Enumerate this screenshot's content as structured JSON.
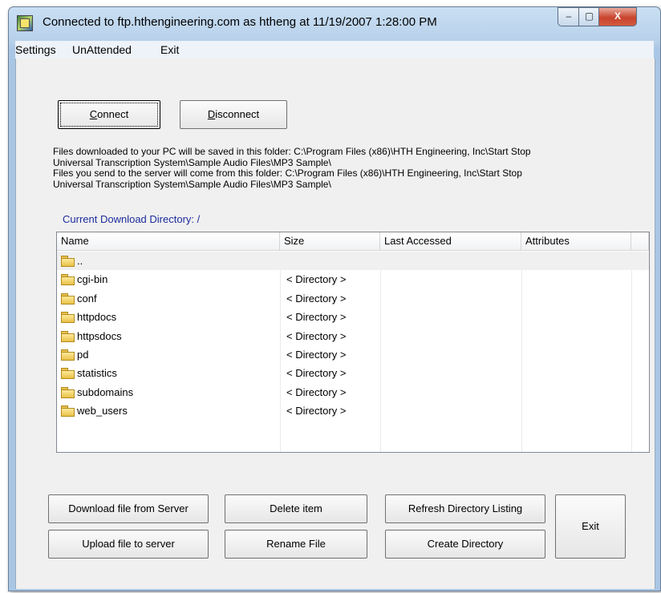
{
  "window": {
    "title": "Connected to ftp.hthengineering.com as htheng at 11/19/2007 1:28:00 PM",
    "controls": {
      "minimize": "–",
      "maximize": "▢",
      "close": "X"
    }
  },
  "menu": [
    "Settings",
    "UnAttended",
    "Exit"
  ],
  "top_buttons": {
    "connect": {
      "underline": "C",
      "rest": "onnect"
    },
    "disconnect": {
      "underline": "D",
      "rest": "isconnect"
    }
  },
  "info": {
    "download_line1": "Files downloaded to your PC will be saved in this folder: C:\\Program Files (x86)\\HTH Engineering, Inc\\Start Stop",
    "download_line2": "Universal Transcription System\\Sample Audio Files\\MP3 Sample\\",
    "upload_line1": "Files you send to the server will come from this folder: C:\\Program Files (x86)\\HTH Engineering, Inc\\Start Stop",
    "upload_line2": "Universal Transcription System\\Sample Audio Files\\MP3 Sample\\"
  },
  "current_dir": "Current Download Directory: /",
  "columns": [
    "Name",
    "Size",
    "Last Accessed",
    "Attributes"
  ],
  "rows": [
    {
      "name": "..",
      "size": ""
    },
    {
      "name": "cgi-bin",
      "size": "< Directory >"
    },
    {
      "name": "conf",
      "size": "< Directory >"
    },
    {
      "name": "httpdocs",
      "size": "< Directory >"
    },
    {
      "name": "httpsdocs",
      "size": "< Directory >"
    },
    {
      "name": "pd",
      "size": "< Directory >"
    },
    {
      "name": "statistics",
      "size": "< Directory >"
    },
    {
      "name": "subdomains",
      "size": "< Directory >"
    },
    {
      "name": "web_users",
      "size": "< Directory >"
    }
  ],
  "bottom_buttons": {
    "download": "Download file from Server",
    "upload": "Upload file to server",
    "delete": "Delete item",
    "rename": "Rename File",
    "refresh": "Refresh Directory Listing",
    "create_dir": "Create Directory",
    "exit": "Exit"
  }
}
